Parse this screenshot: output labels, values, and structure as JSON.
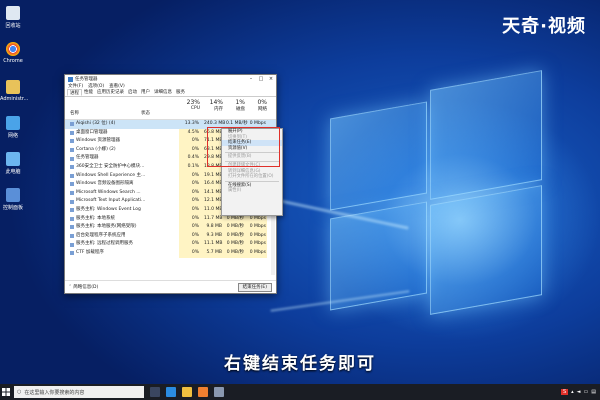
{
  "watermark": "天奇·视频",
  "subtitle": "右键结束任务即可",
  "desktop_icons": [
    {
      "label": "回收站",
      "icon": "recycle-bin-icon"
    },
    {
      "label": "Chrome",
      "icon": "chrome-icon"
    },
    {
      "label": "Administr...",
      "icon": "user-folder-icon"
    },
    {
      "label": "网络",
      "icon": "network-icon"
    },
    {
      "label": "此电脑",
      "icon": "computer-icon"
    },
    {
      "label": "控制面板",
      "icon": "control-panel-icon"
    }
  ],
  "task_manager": {
    "title": "任务管理器",
    "menu": [
      "文件(F)",
      "选项(O)",
      "查看(V)"
    ],
    "tabs": [
      "进程",
      "性能",
      "应用历史记录",
      "启动",
      "用户",
      "详细信息",
      "服务"
    ],
    "headers": {
      "name": "名称",
      "status": "状态",
      "cpu_pct": "23%",
      "cpu": "CPU",
      "mem_pct": "14%",
      "mem": "内存",
      "disk_pct": "1%",
      "disk": "磁盘",
      "net_pct": "0%",
      "net": "网络"
    },
    "rows": [
      {
        "name": "Aiqishi (32 位) (4)",
        "cpu": "13.3%",
        "mem": "240.3 MB",
        "disk": "0.1 MB/秒",
        "net": "0 Mbps"
      },
      {
        "name": "桌面窗口管理器",
        "cpu": "4.5%",
        "mem": "66.8 MB",
        "disk": "",
        "net": ""
      },
      {
        "name": "Windows 资源管理器",
        "cpu": "0%",
        "mem": "71.1 MB",
        "disk": "",
        "net": ""
      },
      {
        "name": "Cortana (小娜) (2)",
        "cpu": "0%",
        "mem": "63.1 MB",
        "disk": "",
        "net": ""
      },
      {
        "name": "任务管理器",
        "cpu": "0.4%",
        "mem": "29.8 MB",
        "disk": "",
        "net": ""
      },
      {
        "name": "360安全卫士 安全防护中心模块...",
        "cpu": "0.1%",
        "mem": "18.8 MB",
        "disk": "",
        "net": ""
      },
      {
        "name": "Windows Shell Experience 主...",
        "cpu": "0%",
        "mem": "19.1 MB",
        "disk": "",
        "net": ""
      },
      {
        "name": "Windows 音频设备图形隔离",
        "cpu": "0%",
        "mem": "16.4 MB",
        "disk": "",
        "net": ""
      },
      {
        "name": "Microsoft Windows Search ...",
        "cpu": "0%",
        "mem": "14.1 MB",
        "disk": "",
        "net": ""
      },
      {
        "name": "Microsoft Text Input Applicati...",
        "cpu": "0%",
        "mem": "12.1 MB",
        "disk": "0 MB/秒",
        "net": "0 Mbps"
      },
      {
        "name": "服务主机: Windows Event Log",
        "cpu": "0%",
        "mem": "11.0 MB",
        "disk": "0.1 MB/秒",
        "net": "0 Mbps"
      },
      {
        "name": "服务主机: 本地系统",
        "cpu": "0%",
        "mem": "11.7 MB",
        "disk": "0 MB/秒",
        "net": "0 Mbps"
      },
      {
        "name": "服务主机: 本地服务(网络受限)",
        "cpu": "0%",
        "mem": "9.8 MB",
        "disk": "0 MB/秒",
        "net": "0 Mbps"
      },
      {
        "name": "后台处理程序子系统应用",
        "cpu": "0%",
        "mem": "9.3 MB",
        "disk": "0 MB/秒",
        "net": "0 Mbps"
      },
      {
        "name": "服务主机: 远程过程调用服务",
        "cpu": "0%",
        "mem": "11.1 MB",
        "disk": "0 MB/秒",
        "net": "0 Mbps"
      },
      {
        "name": "CTF 加载程序",
        "cpu": "0%",
        "mem": "5.7 MB",
        "disk": "0 MB/秒",
        "net": "0 Mbps"
      }
    ],
    "footer_details": "简略信息(D)",
    "end_task": "结束任务(E)"
  },
  "context_menu": {
    "items": [
      {
        "label": "展开(P)",
        "dim": false,
        "highlight": false
      },
      {
        "label": "切换到(T)",
        "dim": true,
        "highlight": false
      },
      {
        "label": "结束任务(E)",
        "dim": false,
        "highlight": true
      },
      {
        "label": "资源值(V)",
        "dim": false,
        "highlight": false
      },
      {
        "label": "提供反馈(B)",
        "dim": true,
        "highlight": false
      },
      {
        "label": "创建转储文件(C)",
        "dim": true,
        "highlight": false
      },
      {
        "label": "转到详细信息(G)",
        "dim": true,
        "highlight": false
      },
      {
        "label": "打开文件所在的位置(O)",
        "dim": true,
        "highlight": false
      },
      {
        "label": "在线搜索(S)",
        "dim": false,
        "highlight": false
      },
      {
        "label": "属性(I)",
        "dim": true,
        "highlight": false
      }
    ]
  },
  "taskbar": {
    "search_placeholder": "在这里输入你要搜索的内容",
    "accent": "#e0302a"
  }
}
